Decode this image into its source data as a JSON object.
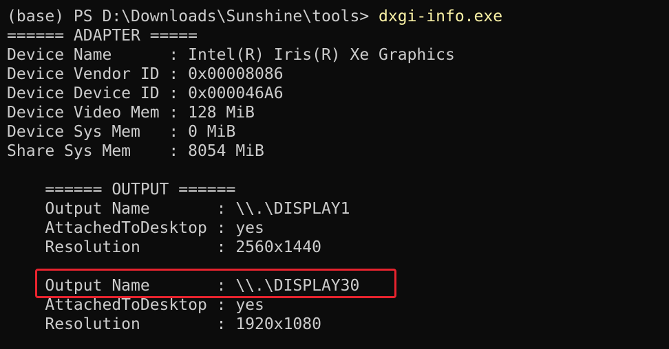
{
  "terminal": {
    "prompt": "(base) PS D:\\Downloads\\Sunshine\\tools> ",
    "command": "dxgi-info.exe",
    "lines": [
      "====== ADAPTER =====",
      "Device Name      : Intel(R) Iris(R) Xe Graphics",
      "Device Vendor ID : 0x00008086",
      "Device Device ID : 0x000046A6",
      "Device Video Mem : 128 MiB",
      "Device Sys Mem   : 0 MiB",
      "Share Sys Mem    : 8054 MiB",
      "",
      "    ====== OUTPUT ======",
      "    Output Name       : \\\\.\\DISPLAY1",
      "    AttachedToDesktop : yes",
      "    Resolution        : 2560x1440",
      "",
      "    Output Name       : \\\\.\\DISPLAY30",
      "    AttachedToDesktop : yes",
      "    Resolution        : 1920x1080"
    ]
  },
  "colors": {
    "background": "#0c0c0c",
    "text": "#cccccc",
    "command": "#f9f1a5",
    "highlight_border": "#e8232e"
  }
}
